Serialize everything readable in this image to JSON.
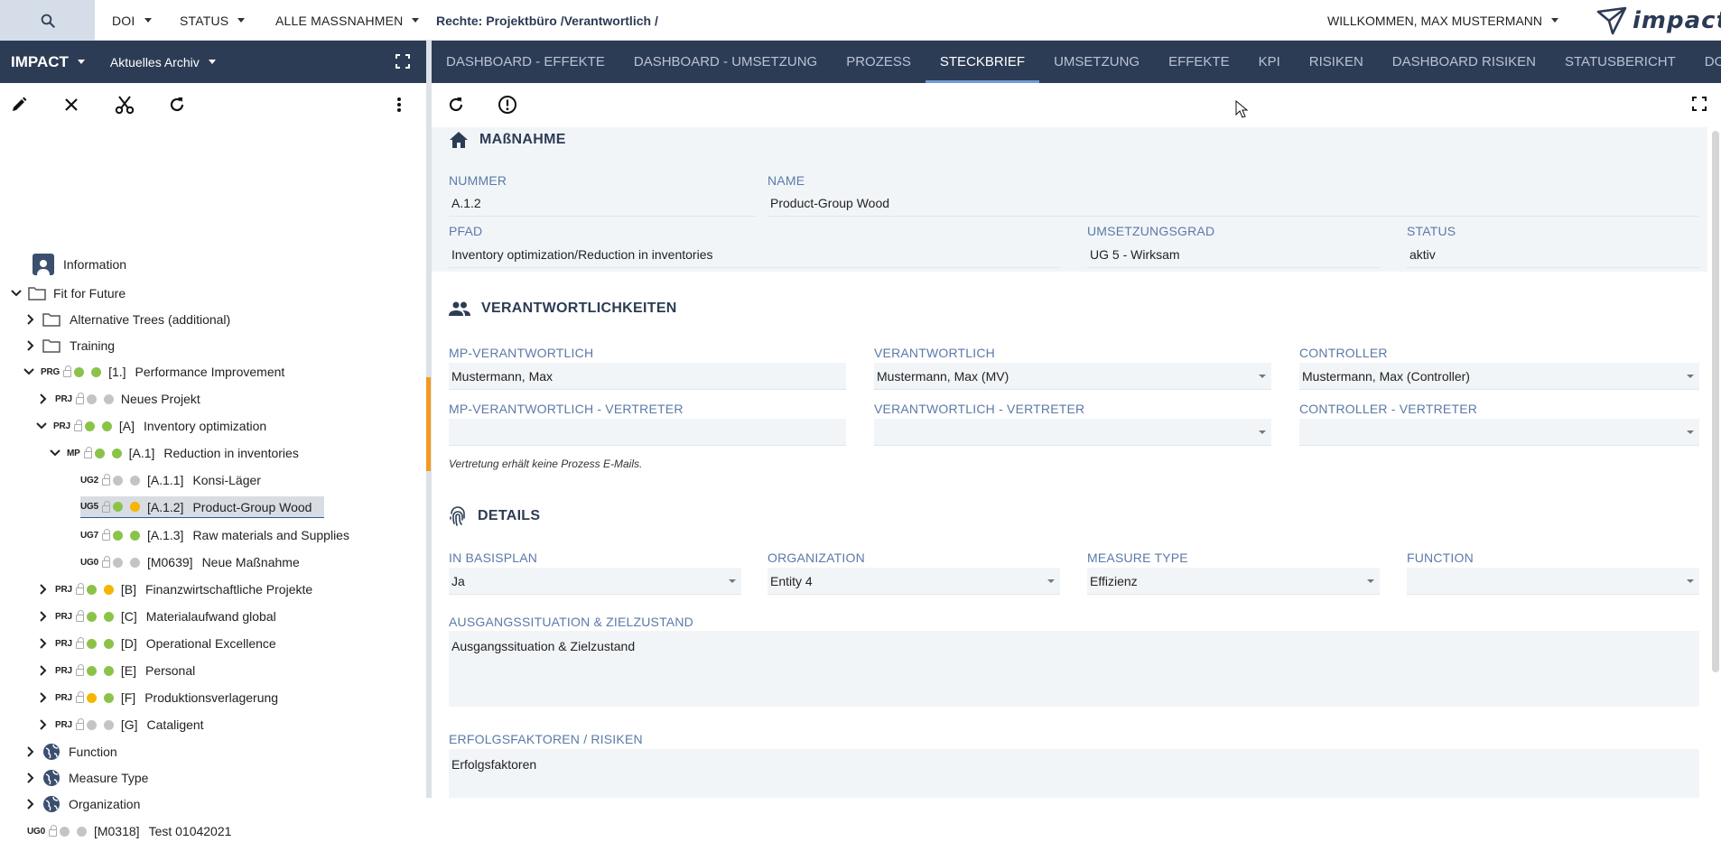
{
  "topbar": {
    "menus": [
      "DOI",
      "STATUS",
      "ALLE MASSNAHMEN"
    ],
    "rechte": "Rechte: Projektbüro /Verantwortlich /",
    "welcome": "WILLKOMMEN, MAX MUSTERMANN",
    "logo_text": "impact"
  },
  "sidebar": {
    "app_name": "IMPACT",
    "archive": "Aktuelles Archiv",
    "tree": {
      "information": "Information",
      "fit_for_future": "Fit for Future",
      "alternative_trees": "Alternative Trees (additional)",
      "training": "Training",
      "prg_tag": "PRG",
      "prg_code": "[1.]",
      "prg_label": "Performance Improvement",
      "neues_projekt": {
        "tag": "PRJ",
        "label": "Neues Projekt"
      },
      "inv_opt": {
        "tag": "PRJ",
        "code": "[A]",
        "label": "Inventory optimization"
      },
      "reduction": {
        "tag": "MP",
        "code": "[A.1]",
        "label": "Reduction in inventories"
      },
      "konsi": {
        "tag": "UG2",
        "code": "[A.1.1]",
        "label": "Konsi-Läger"
      },
      "wood": {
        "tag": "UG5",
        "code": "[A.1.2]",
        "label": "Product-Group Wood"
      },
      "raw": {
        "tag": "UG7",
        "code": "[A.1.3]",
        "label": "Raw materials and Supplies"
      },
      "neue_massnahme": {
        "tag": "UG0",
        "code": "[M0639]",
        "label": "Neue Maßnahme"
      },
      "fin": {
        "tag": "PRJ",
        "code": "[B]",
        "label": "Finanzwirtschaftliche Projekte"
      },
      "material": {
        "tag": "PRJ",
        "code": "[C]",
        "label": "Materialaufwand global"
      },
      "opex": {
        "tag": "PRJ",
        "code": "[D]",
        "label": "Operational Excellence"
      },
      "personal": {
        "tag": "PRJ",
        "code": "[E]",
        "label": "Personal"
      },
      "produktion": {
        "tag": "PRJ",
        "code": "[F]",
        "label": "Produktionsverlagerung"
      },
      "cataligent": {
        "tag": "PRJ",
        "code": "[G]",
        "label": "Catalig​ent"
      },
      "function": "Function",
      "measure_type": "Measure Type",
      "organization": "Organization",
      "test": {
        "tag": "UG0",
        "code": "[M0318]",
        "label": "Test 01042021"
      }
    }
  },
  "tabs": [
    "DASHBOARD - EFFEKTE",
    "DASHBOARD - UMSETZUNG",
    "PROZESS",
    "STECKBRIEF",
    "UMSETZUNG",
    "EFFEKTE",
    "KPI",
    "RISIKEN",
    "DASHBOARD RISIKEN",
    "STATUSBERICHT",
    "DOKUMENT"
  ],
  "active_tab": "STECKBRIEF",
  "massnahme": {
    "title": "MAßNAHME",
    "nummer_label": "NUMMER",
    "nummer": "A.1.2",
    "name_label": "NAME",
    "name": "Product-Group Wood",
    "pfad_label": "PFAD",
    "pfad": "Inventory optimization/Reduction in inventories",
    "umsetzungsgrad_label": "UMSETZUNGSGRAD",
    "umsetzungsgrad": "UG 5 - Wirksam",
    "status_label": "STATUS",
    "status": "aktiv"
  },
  "verantwortlich": {
    "title": "VERANTWORTLICHKEITEN",
    "mp_label": "MP-VERANTWORTLICH",
    "mp": "Mustermann, Max",
    "v_label": "VERANTWORTLICH",
    "v": "Mustermann, Max (MV)",
    "c_label": "CONTROLLER",
    "c": "Mustermann, Max (Controller)",
    "mp_vertreter_label": "MP-VERANTWORTLICH - VERTRETER",
    "v_vertreter_label": "VERANTWORTLICH - VERTRETER",
    "c_vertreter_label": "CONTROLLER - VERTRETER",
    "note": "Vertretung erhält keine Prozess E-Mails."
  },
  "details": {
    "title": "DETAILS",
    "basisplan_label": "IN BASISPLAN",
    "basisplan": "Ja",
    "org_label": "ORGANIZATION",
    "org": "Entity 4",
    "mtype_label": "MEASURE TYPE",
    "mtype": "Effizienz",
    "function_label": "FUNCTION",
    "function": "",
    "ausgang_label": "AUSGANGSSITUATION & ZIELZUSTAND",
    "ausgang": "Ausgangssituation & Zielzustand",
    "erfolg_label": "ERFOLGSFAKTOREN / RISIKEN",
    "erfolg": "Erfolgsfaktoren"
  },
  "colors": {
    "navy": "#2d3c55",
    "green": "#8bc34a",
    "yellow": "#f5b500",
    "gray": "#c4c4c4",
    "orange": "#f29a1f"
  }
}
